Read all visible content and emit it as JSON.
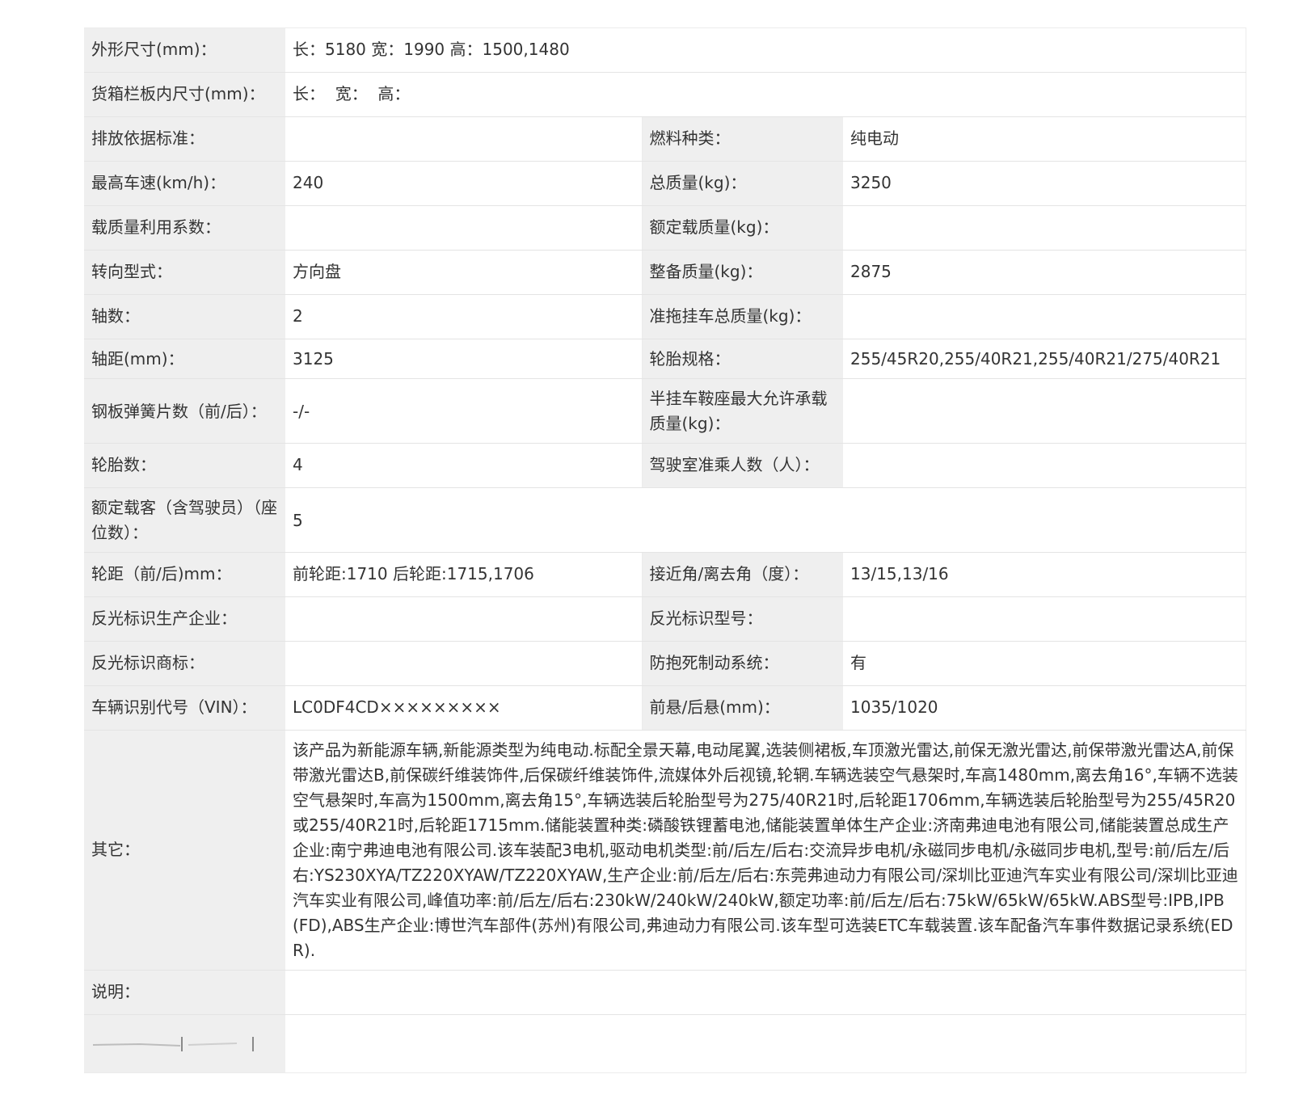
{
  "rows": {
    "dimensions": {
      "label": "外形尺寸(mm)：",
      "value": "长：5180 宽：1990 高：1500,1480"
    },
    "cargo_box": {
      "label": "货箱栏板内尺寸(mm)：",
      "value": "长：  宽：  高："
    },
    "emission_std": {
      "label": "排放依据标准：",
      "value": ""
    },
    "fuel_type": {
      "label": "燃料种类：",
      "value": "纯电动"
    },
    "max_speed": {
      "label": "最高车速(km/h)：",
      "value": "240"
    },
    "total_mass": {
      "label": "总质量(kg)：",
      "value": "3250"
    },
    "load_util": {
      "label": "载质量利用系数：",
      "value": ""
    },
    "rated_load": {
      "label": "额定载质量(kg)：",
      "value": ""
    },
    "steering": {
      "label": "转向型式：",
      "value": "方向盘"
    },
    "curb_mass": {
      "label": "整备质量(kg)：",
      "value": "2875"
    },
    "axles": {
      "label": "轴数：",
      "value": "2"
    },
    "trailer_mass": {
      "label": "准拖挂车总质量(kg)：",
      "value": ""
    },
    "wheelbase": {
      "label": "轴距(mm)：",
      "value": "3125"
    },
    "tire_spec": {
      "label": "轮胎规格：",
      "value": "255/45R20,255/40R21,255/40R21/275/40R21"
    },
    "leaf_springs": {
      "label": "钢板弹簧片数（前/后）：",
      "value": "-/-"
    },
    "saddle_load": {
      "label": "半挂车鞍座最大允许承载质量(kg)：",
      "value": ""
    },
    "tire_count": {
      "label": "轮胎数：",
      "value": "4"
    },
    "cab_seats": {
      "label": "驾驶室准乘人数（人）：",
      "value": ""
    },
    "passengers": {
      "label": "额定载客（含驾驶员）（座位数）：",
      "value": "5"
    },
    "track": {
      "label": "轮距（前/后)mm：",
      "value": "前轮距:1710 后轮距:1715,1706"
    },
    "angles": {
      "label": "接近角/离去角（度）：",
      "value": "13/15,13/16"
    },
    "reflector_maker": {
      "label": "反光标识生产企业：",
      "value": ""
    },
    "reflector_model": {
      "label": "反光标识型号：",
      "value": ""
    },
    "reflector_brand": {
      "label": "反光标识商标：",
      "value": ""
    },
    "abs": {
      "label": "防抱死制动系统：",
      "value": "有"
    },
    "vin": {
      "label": "车辆识别代号（VIN）：",
      "value": "LC0DF4CD×××××××××"
    },
    "overhang": {
      "label": "前悬/后悬(mm)：",
      "value": "1035/1020"
    },
    "other": {
      "label": "其它：",
      "value": "该产品为新能源车辆,新能源类型为纯电动.标配全景天幕,电动尾翼,选装侧裙板,车顶激光雷达,前保无激光雷达,前保带激光雷达A,前保带激光雷达B,前保碳纤维装饰件,后保碳纤维装饰件,流媒体外后视镜,轮辋.车辆选装空气悬架时,车高1480mm,离去角16°,车辆不选装空气悬架时,车高为1500mm,离去角15°,车辆选装后轮胎型号为275/40R21时,后轮距1706mm,车辆选装后轮胎型号为255/45R20或255/40R21时,后轮距1715mm.储能装置种类:磷酸铁锂蓄电池,储能装置单体生产企业:济南弗迪电池有限公司,储能装置总成生产企业:南宁弗迪电池有限公司.该车装配3电机,驱动电机类型:前/后左/后右:交流异步电机/永磁同步电机/永磁同步电机,型号:前/后左/后右:YS230XYA/TZ220XYAW/TZ220XYAW,生产企业:前/后左/后右:东莞弗迪动力有限公司/深圳比亚迪汽车实业有限公司/深圳比亚迪汽车实业有限公司,峰值功率:前/后左/后右:230kW/240kW/240kW,额定功率:前/后左/后右:75kW/65kW/65kW.ABS型号:IPB,IPB(FD),ABS生产企业:博世汽车部件(苏州)有限公司,弗迪动力有限公司.该车型可选装ETC车载装置.该车配备汽车事件数据记录系统(EDR)."
    },
    "notes": {
      "label": "说明：",
      "value": ""
    }
  },
  "colors": {
    "label_bg": "#efefef",
    "value_bg": "#ffffff",
    "text": "#333333",
    "border": "#e4e4e4"
  }
}
